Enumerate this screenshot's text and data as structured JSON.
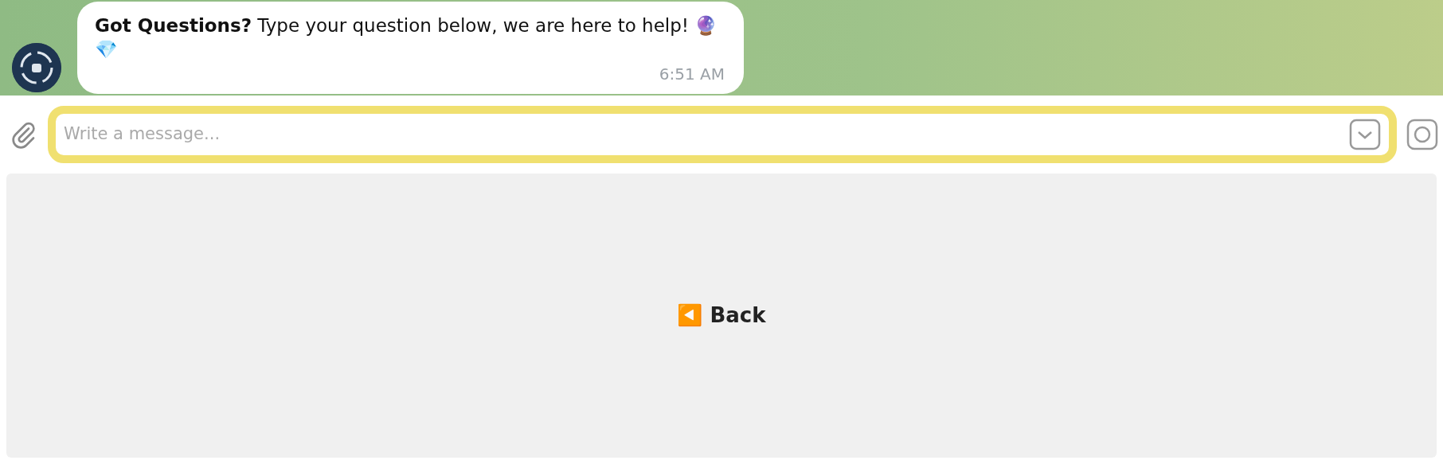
{
  "chat": {
    "messages": [
      {
        "text": "**Got Questions?** Type your question below, we are here to help! 🔮 💎",
        "time": "6:51 AM"
      }
    ]
  },
  "composer": {
    "placeholder": "Write a message...",
    "highlighted": true
  },
  "keyboard": {
    "buttons": [
      {
        "label": "◀️ Back"
      }
    ]
  }
}
